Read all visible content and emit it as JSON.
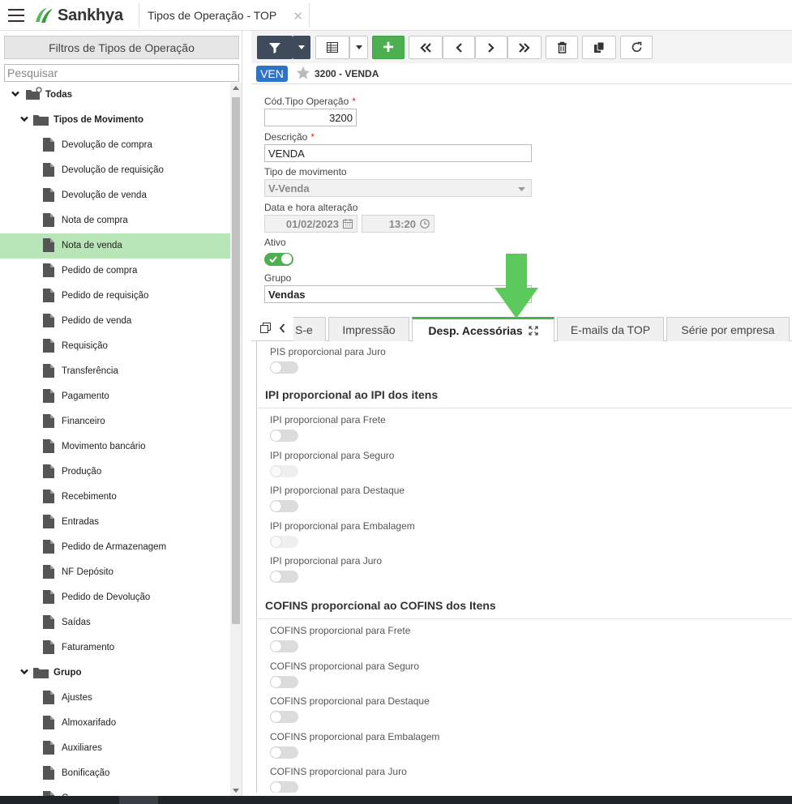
{
  "app": {
    "brand": "Sankhya",
    "tab_title": "Tipos de Operação - TOP",
    "close_glyph": "✕"
  },
  "left_panel": {
    "filters_button": "Filtros de Tipos de Operação",
    "search_placeholder": "Pesquisar",
    "tree": [
      {
        "label": "Todas",
        "level": 0,
        "kind": "root",
        "expanded": true
      },
      {
        "label": "Tipos de Movimento",
        "level": 1,
        "kind": "folder",
        "expanded": true
      },
      {
        "label": "Devolução de compra",
        "level": 2,
        "kind": "file"
      },
      {
        "label": "Devolução de requisição",
        "level": 2,
        "kind": "file"
      },
      {
        "label": "Devolução de venda",
        "level": 2,
        "kind": "file"
      },
      {
        "label": "Nota de compra",
        "level": 2,
        "kind": "file"
      },
      {
        "label": "Nota de venda",
        "level": 2,
        "kind": "file",
        "selected": true
      },
      {
        "label": "Pedido de compra",
        "level": 2,
        "kind": "file"
      },
      {
        "label": "Pedido de requisição",
        "level": 2,
        "kind": "file"
      },
      {
        "label": "Pedido de venda",
        "level": 2,
        "kind": "file"
      },
      {
        "label": "Requisição",
        "level": 2,
        "kind": "file"
      },
      {
        "label": "Transferência",
        "level": 2,
        "kind": "file"
      },
      {
        "label": "Pagamento",
        "level": 2,
        "kind": "file"
      },
      {
        "label": "Financeiro",
        "level": 2,
        "kind": "file"
      },
      {
        "label": "Movimento bancário",
        "level": 2,
        "kind": "file"
      },
      {
        "label": "Produção",
        "level": 2,
        "kind": "file"
      },
      {
        "label": "Recebimento",
        "level": 2,
        "kind": "file"
      },
      {
        "label": "Entradas",
        "level": 2,
        "kind": "file"
      },
      {
        "label": "Pedido de Armazenagem",
        "level": 2,
        "kind": "file"
      },
      {
        "label": "NF Depósito",
        "level": 2,
        "kind": "file"
      },
      {
        "label": "Pedido de Devolução",
        "level": 2,
        "kind": "file"
      },
      {
        "label": "Saídas",
        "level": 2,
        "kind": "file"
      },
      {
        "label": "Faturamento",
        "level": 2,
        "kind": "file"
      },
      {
        "label": "Grupo",
        "level": 1,
        "kind": "folder",
        "expanded": true
      },
      {
        "label": "Ajustes",
        "level": 2,
        "kind": "file"
      },
      {
        "label": "Almoxarifado",
        "level": 2,
        "kind": "file"
      },
      {
        "label": "Auxiliares",
        "level": 2,
        "kind": "file"
      },
      {
        "label": "Bonificação",
        "level": 2,
        "kind": "file"
      },
      {
        "label": "C...",
        "level": 2,
        "kind": "file"
      }
    ]
  },
  "toolbar": {
    "buttons": [
      "filter-icon",
      "dropdown-caret-icon",
      "grid-view-icon",
      "dropdown-caret-icon",
      "add-icon",
      "first-icon",
      "previous-icon",
      "next-icon",
      "last-icon",
      "delete-icon",
      "copy-icon",
      "refresh-icon"
    ],
    "add_glyph": "+",
    "accent": "#4caf50"
  },
  "record": {
    "badge": "VEN",
    "title": "3200 - VENDA",
    "badge_color": "#2e73c7"
  },
  "form": {
    "cod_label": "Cód.Tipo Operação",
    "cod_value": "3200",
    "desc_label": "Descrição",
    "desc_value": "VENDA",
    "tipo_label": "Tipo de movimento",
    "tipo_value": "V-Venda",
    "data_label": "Data e hora alteração",
    "date_value": "01/02/2023",
    "time_value": "13:20",
    "ativo_label": "Ativo",
    "ativo_on": true,
    "grupo_label": "Grupo",
    "grupo_value": "Vendas",
    "required_mark": "*"
  },
  "tabs": [
    {
      "label": "S-e"
    },
    {
      "label": "Impressão"
    },
    {
      "label": "Desp. Acessórias",
      "active": true
    },
    {
      "label": "E-mails da TOP"
    },
    {
      "label": "Série por empresa"
    }
  ],
  "content": {
    "pis_juro_label": "PIS proporcional para Juro",
    "ipi_section": "IPI proporcional ao IPI dos itens",
    "ipi_items": [
      {
        "label": "IPI proporcional para Frete",
        "state": "off"
      },
      {
        "label": "IPI proporcional para Seguro",
        "state": "disabled"
      },
      {
        "label": "IPI proporcional para Destaque",
        "state": "off"
      },
      {
        "label": "IPI proporcional para Embalagem",
        "state": "disabled"
      },
      {
        "label": "IPI proporcional para Juro",
        "state": "off"
      }
    ],
    "cofins_section": "COFINS proporcional ao COFINS dos Itens",
    "cofins_items": [
      {
        "label": "COFINS proporcional para Frete",
        "state": "off"
      },
      {
        "label": "COFINS proporcional para Seguro",
        "state": "off"
      },
      {
        "label": "COFINS proporcional para Destaque",
        "state": "off"
      },
      {
        "label": "COFINS proporcional para Embalagem",
        "state": "off"
      },
      {
        "label": "COFINS proporcional para Juro",
        "state": "off"
      }
    ]
  }
}
